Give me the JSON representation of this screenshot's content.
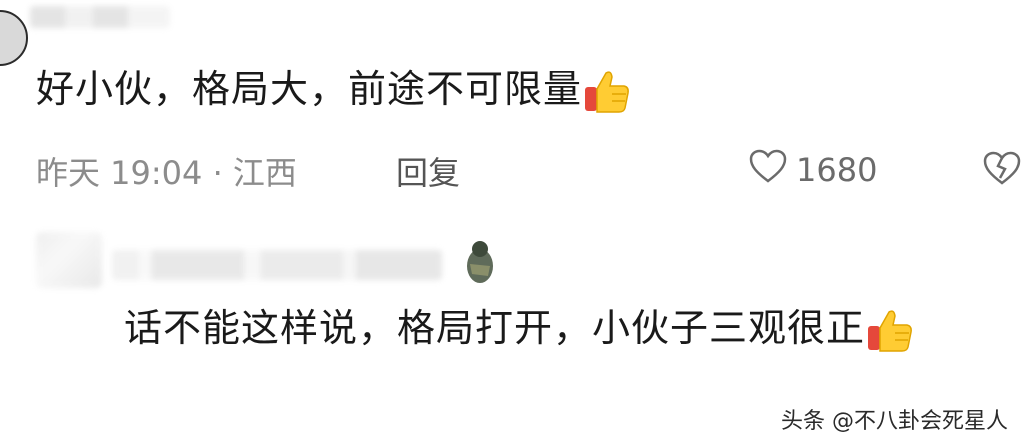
{
  "comment1": {
    "text": "好小伙，格局大，前途不可限量",
    "time_location": "昨天 19:04 · 江西",
    "reply_label": "回复",
    "like_count": "1680",
    "emoji": "thumbs-up-icon"
  },
  "comment2": {
    "text": "话不能这样说，格局打开，小伙子三观很正",
    "emoji": "thumbs-up-icon"
  },
  "watermark": "头条 @不八卦会死星人",
  "colors": {
    "meta_gray": "#8c8c8c",
    "thumb_yellow": "#ffcc33",
    "thumb_red": "#e5483b"
  }
}
